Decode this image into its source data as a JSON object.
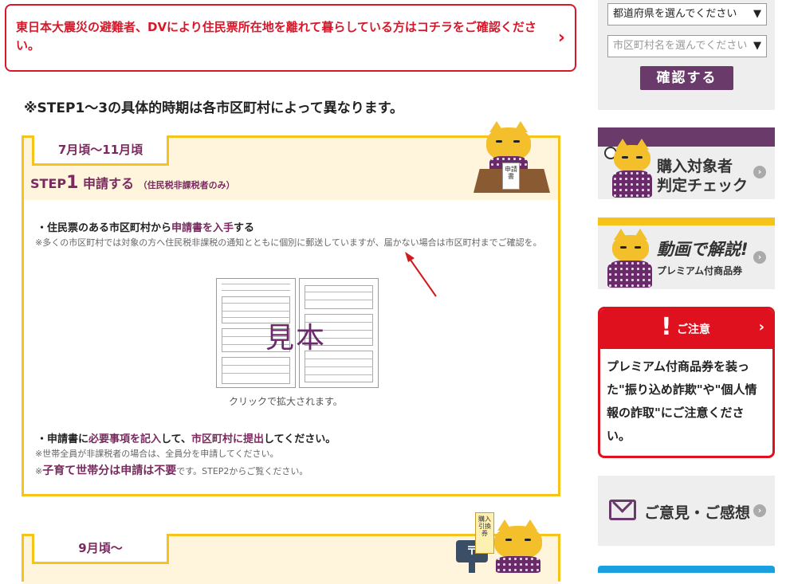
{
  "notice": {
    "text": "東日本大震災の避難者、DVにより住民票所在地を離れて暮らしている方はコチラをご確認ください。",
    "chevron": "›"
  },
  "heading": "※STEP1〜3の具体的時期は各市区町村によって異なります。",
  "step1": {
    "period": "7月頃〜11月頃",
    "step_word": "STEP",
    "step_num": "1",
    "step_action": "申請する",
    "step_sub": "（住民税非課税者のみ）",
    "item1": {
      "pre": "・住民票のある市区町村から",
      "hl": "申請書を入手",
      "post": "する"
    },
    "item1_note": "※多くの市区町村では対象の方へ住民税非課税の通知とともに個別に郵送していますが、届かない場合は市区町村までご確認を。",
    "sample_label": "見本",
    "caption": "クリックで拡大されます。",
    "item2": {
      "p1": "・申請書に",
      "h1": "必要事項を記入",
      "p2": "して、",
      "h2": "市区町村に提出",
      "p3": "してください。"
    },
    "item2_note1": "※世帯全員が非課税者の場合は、全員分を申請してください。",
    "item2_note2_pre": "※",
    "item2_note2_big": "子育て世帯分は申請は不要",
    "item2_note2_post": "です。STEP2からご覧ください。",
    "desk_sign": "申請書"
  },
  "step2": {
    "period": "9月頃〜",
    "post_sign": "購入引換券"
  },
  "sidebar": {
    "prefecture_select": "都道府県を選んでください",
    "city_select": "市区町村名を選んでください",
    "select_arrow": "▼",
    "confirm_button": "確認する",
    "card1": {
      "line1": "購入対象者",
      "line2": "判定チェック",
      "arrow": "›"
    },
    "card2": {
      "line1": "動画で解説!",
      "line2": "プレミアム付商品券",
      "arrow": "›"
    },
    "alert": {
      "title": "ご注意",
      "bang": "!",
      "chevron": "›",
      "body": "プレミアム付商品券を装った\"振り込め詐欺\"や\"個人情報の詐取\"にご注意ください。"
    },
    "feedback": {
      "label": "ご意見・ご感想",
      "arrow": "›"
    }
  },
  "colors": {
    "accent_red": "#d7182a",
    "brand_purple": "#6a2a6a",
    "step_yellow": "#f5c31a",
    "annotation_arrow": "#d11a1a"
  }
}
